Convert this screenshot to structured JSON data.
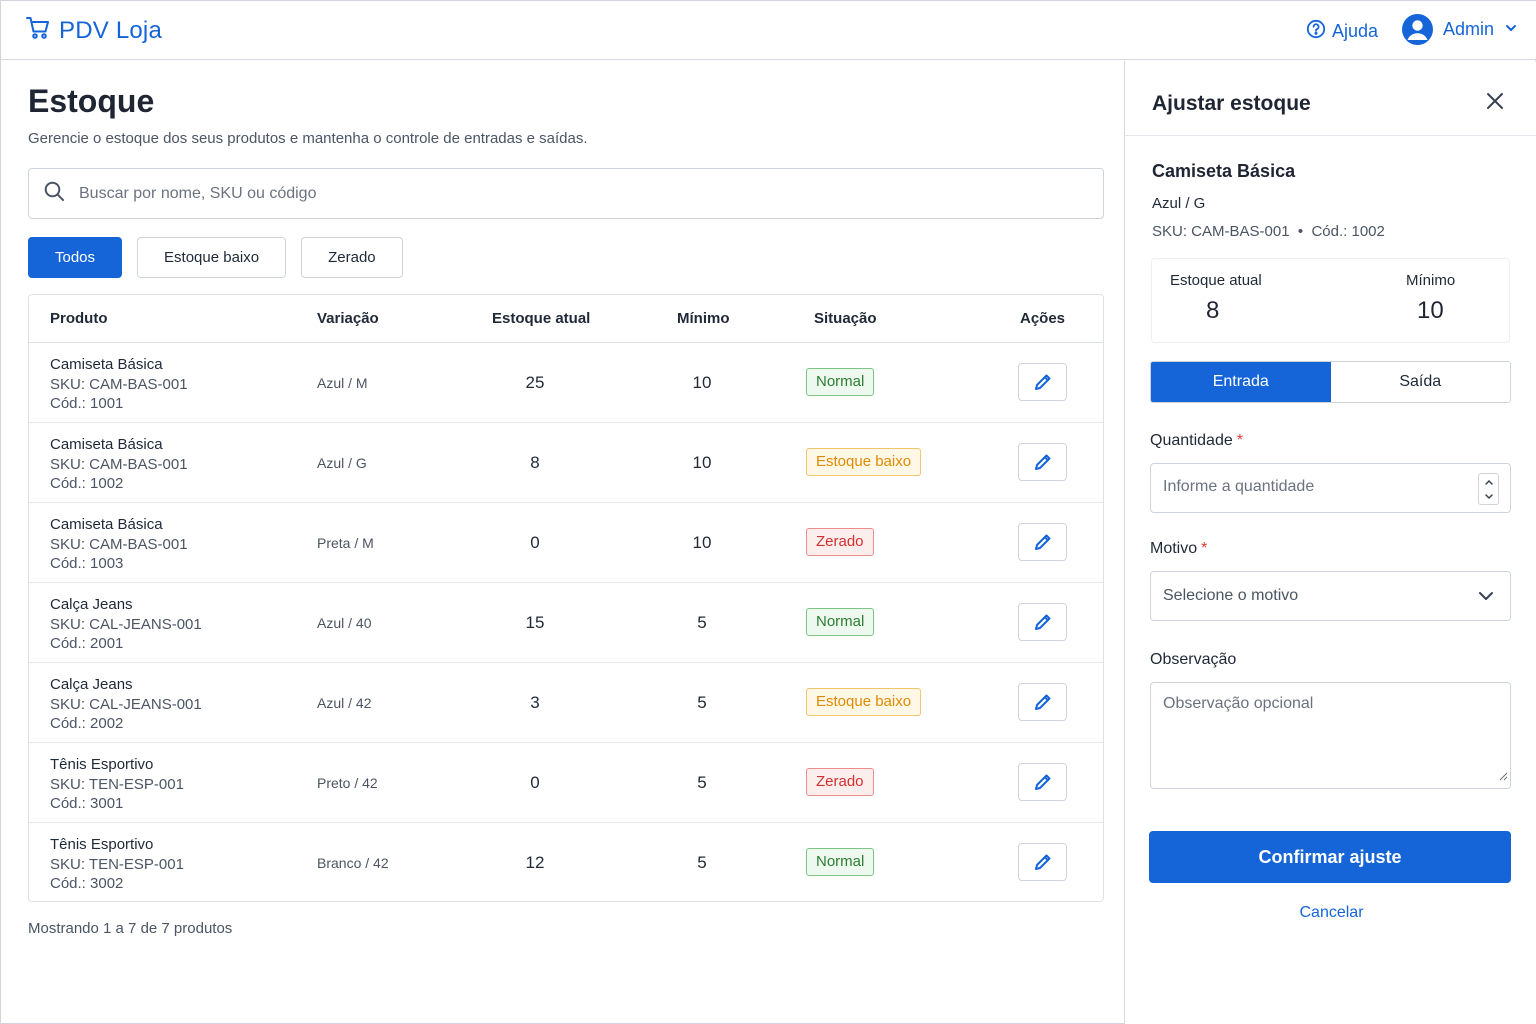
{
  "app": {
    "brand": "PDV Loja",
    "help_label": "Ajuda",
    "user_name": "Admin"
  },
  "page": {
    "title": "Estoque",
    "subtitle": "Gerencie o estoque dos seus produtos e mantenha o controle de entradas e saídas.",
    "search_placeholder": "Buscar por nome, SKU ou código",
    "filters": [
      "Todos",
      "Estoque baixo",
      "Zerado"
    ],
    "active_filter": "Todos"
  },
  "table": {
    "headers": [
      "Produto",
      "Variação",
      "Estoque atual",
      "Mínimo",
      "Situação",
      "Ações"
    ],
    "rows": [
      {
        "name": "Camiseta Básica",
        "sku": "SKU: CAM-BAS-001",
        "cod": "Cód.: 1001",
        "variation": "Azul / M",
        "stock": "25",
        "min": "10",
        "status": "Normal",
        "status_type": "normal"
      },
      {
        "name": "Camiseta Básica",
        "sku": "SKU: CAM-BAS-001",
        "cod": "Cód.: 1002",
        "variation": "Azul / G",
        "stock": "8",
        "min": "10",
        "status": "Estoque baixo",
        "status_type": "low"
      },
      {
        "name": "Camiseta Básica",
        "sku": "SKU: CAM-BAS-001",
        "cod": "Cód.: 1003",
        "variation": "Preta / M",
        "stock": "0",
        "min": "10",
        "status": "Zerado",
        "status_type": "zero"
      },
      {
        "name": "Calça Jeans",
        "sku": "SKU: CAL-JEANS-001",
        "cod": "Cód.: 2001",
        "variation": "Azul / 40",
        "stock": "15",
        "min": "5",
        "status": "Normal",
        "status_type": "normal"
      },
      {
        "name": "Calça Jeans",
        "sku": "SKU: CAL-JEANS-001",
        "cod": "Cód.: 2002",
        "variation": "Azul / 42",
        "stock": "3",
        "min": "5",
        "status": "Estoque baixo",
        "status_type": "low"
      },
      {
        "name": "Tênis Esportivo",
        "sku": "SKU: TEN-ESP-001",
        "cod": "Cód.: 3001",
        "variation": "Preto / 42",
        "stock": "0",
        "min": "5",
        "status": "Zerado",
        "status_type": "zero"
      },
      {
        "name": "Tênis Esportivo",
        "sku": "SKU: TEN-ESP-001",
        "cod": "Cód.: 3002",
        "variation": "Branco / 42",
        "stock": "12",
        "min": "5",
        "status": "Normal",
        "status_type": "normal"
      }
    ],
    "footer": "Mostrando 1 a 7 de 7 produtos",
    "edit_icon": "pencil-icon"
  },
  "panel": {
    "title": "Ajustar estoque",
    "product_name": "Camiseta Básica",
    "variation": "Azul / G",
    "ids": "SKU: CAM-BAS-001  •  Cód.: 1002",
    "stock_label": "Estoque atual",
    "stock_value": "8",
    "min_label": "Mínimo",
    "min_value": "10",
    "segments": [
      "Entrada",
      "Saída"
    ],
    "active_segment": "Entrada",
    "quantity_label": "Quantidade",
    "quantity_placeholder": "Informe a quantidade",
    "reason_label": "Motivo",
    "reason_placeholder": "Selecione o motivo",
    "note_label": "Observação",
    "note_placeholder": "Observação opcional",
    "required_mark": "*",
    "confirm_label": "Confirmar ajuste",
    "cancel_label": "Cancelar"
  },
  "colors": {
    "primary": "#1565d8",
    "normal": "#2e7d32",
    "low": "#e08a00",
    "zero": "#d32f2f"
  }
}
